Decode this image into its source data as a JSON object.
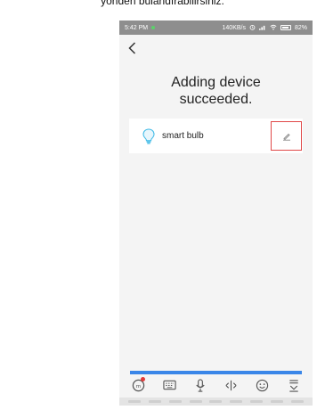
{
  "caption": "yönden bulandırabilirsiniz.",
  "status_bar": {
    "time": "5:42 PM",
    "network": "140KB/s",
    "battery": "82%",
    "indicator_color": "#5cd16b"
  },
  "screen": {
    "title_line1": "Adding device",
    "title_line2": "succeeded."
  },
  "device": {
    "name": "smart bulb",
    "icon": "bulb-icon"
  },
  "colors": {
    "accent": "#3a86e8",
    "highlight": "#e04848"
  },
  "toolbar": {
    "icons": [
      "ai-assistant-icon",
      "keyboard-icon",
      "microphone-icon",
      "cursor-move-icon",
      "emoji-icon",
      "collapse-keyboard-icon"
    ]
  }
}
